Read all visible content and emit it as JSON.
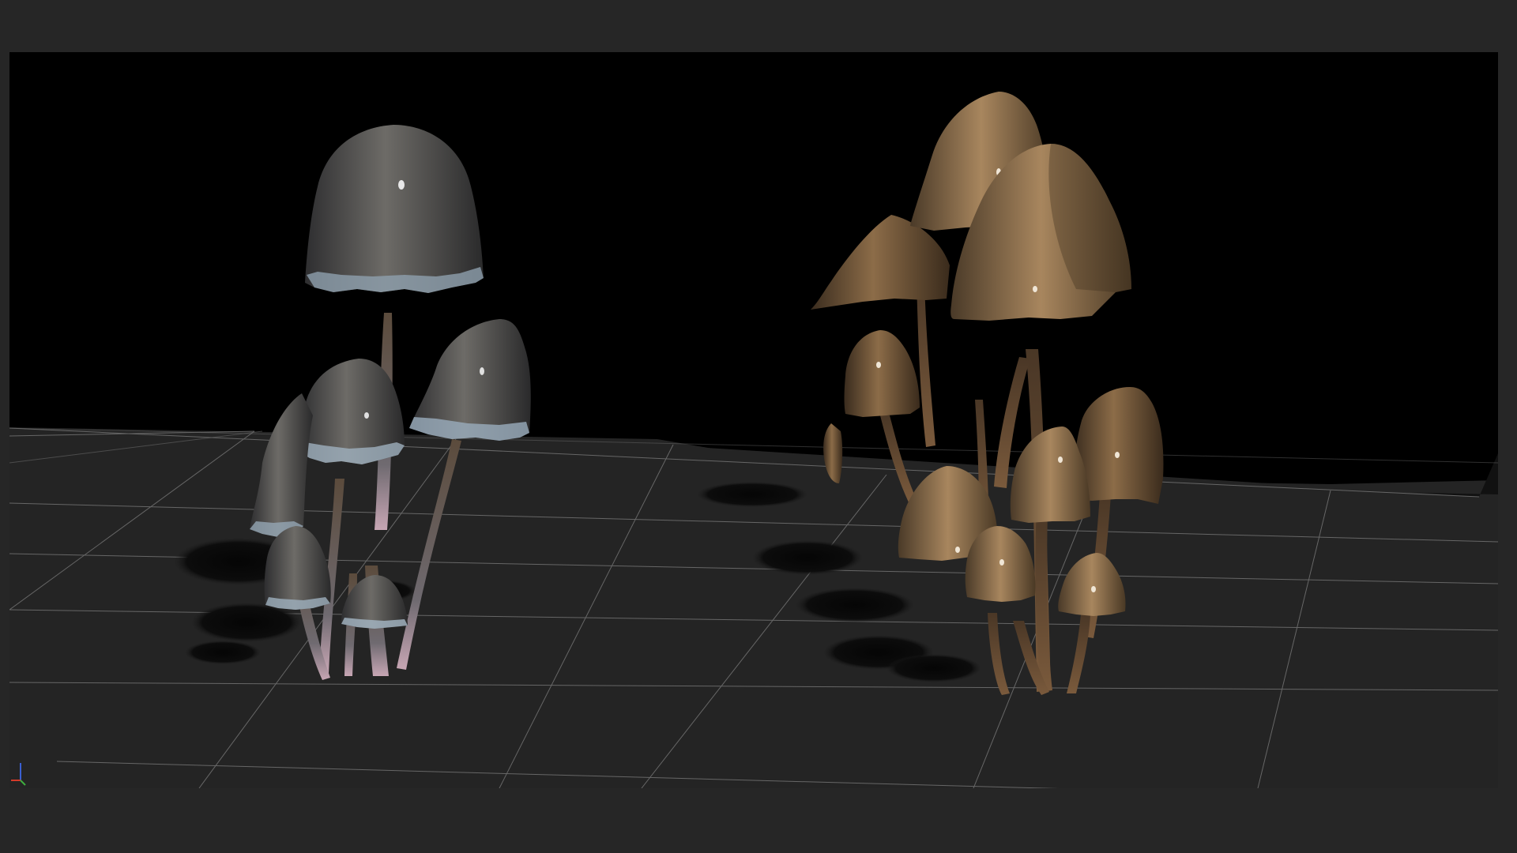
{
  "window": {
    "background_color": "#262626"
  },
  "viewport": {
    "sky_color": "#000000",
    "ground_color": "#252525",
    "grid_color": "#8a8a8a",
    "shadow_color": "#0b0b0b"
  },
  "scene": {
    "objects": [
      {
        "name": "mushroom-cluster-left",
        "type": "ink-cap mushroom group",
        "cap_color": "#5b5a58",
        "gill_color": "#9fb0be",
        "stem_color": "#6e5a48"
      },
      {
        "name": "mushroom-cluster-right",
        "type": "liberty-cap mushroom group",
        "cap_color": "#7a5e3f",
        "stem_color": "#5a4330"
      }
    ]
  },
  "axis_gizmo": {
    "axes": [
      "x",
      "y",
      "z"
    ],
    "colors": {
      "x": "#d23a2a",
      "y": "#3fae3f",
      "z": "#3a5fd2"
    }
  }
}
